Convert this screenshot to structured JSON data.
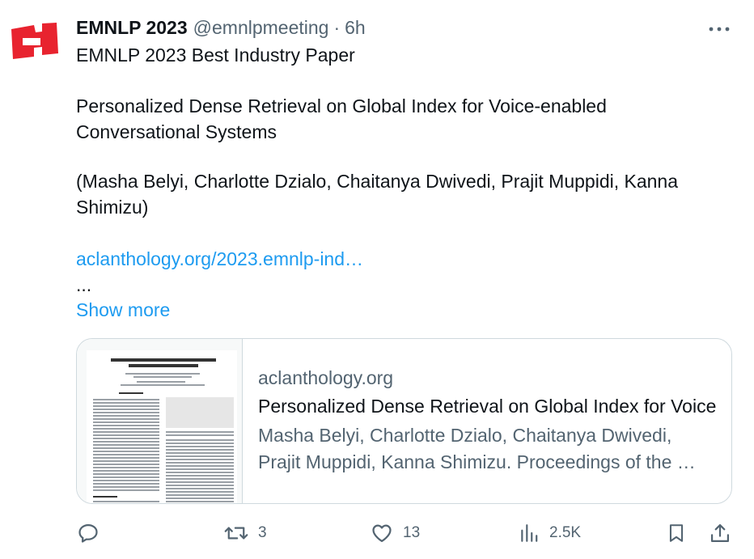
{
  "author": {
    "name": "EMNLP 2023",
    "handle": "@emnlpmeeting",
    "separator": "·",
    "time": "6h",
    "logo_color": "#e8232f"
  },
  "tweet": {
    "line1": "EMNLP 2023 Best Industry Paper",
    "title_line1": "Personalized Dense Retrieval on Global Index for Voice-enabled",
    "title_line2": "Conversational Systems",
    "authors_line1": "(Masha Belyi, Charlotte Dzialo, Chaitanya Dwivedi, Prajit Muppidi, Kanna",
    "authors_line2": "Shimizu)",
    "link": "aclanthology.org/2023.emnlp-ind…",
    "ellipsis": "...",
    "show_more": "Show more"
  },
  "card": {
    "domain": "aclanthology.org",
    "title": "Personalized Dense Retrieval on Global Index for Voice-enabled Conversational Systems",
    "desc_line1": "Masha Belyi, Charlotte Dzialo, Chaitanya Dwivedi,",
    "desc_line2": "Prajit Muppidi, Kanna Shimizu. Proceedings of the …"
  },
  "actions": {
    "reply": {
      "icon": "reply-icon",
      "count": ""
    },
    "retweet": {
      "icon": "retweet-icon",
      "count": "3"
    },
    "like": {
      "icon": "heart-icon",
      "count": "13"
    },
    "views": {
      "icon": "views-icon",
      "count": "2.5K"
    },
    "bookmark": {
      "icon": "bookmark-icon"
    },
    "share": {
      "icon": "share-icon"
    }
  },
  "colors": {
    "text": "#0f1419",
    "secondary": "#536471",
    "link": "#1d9bf0",
    "border": "#cfd9de"
  }
}
